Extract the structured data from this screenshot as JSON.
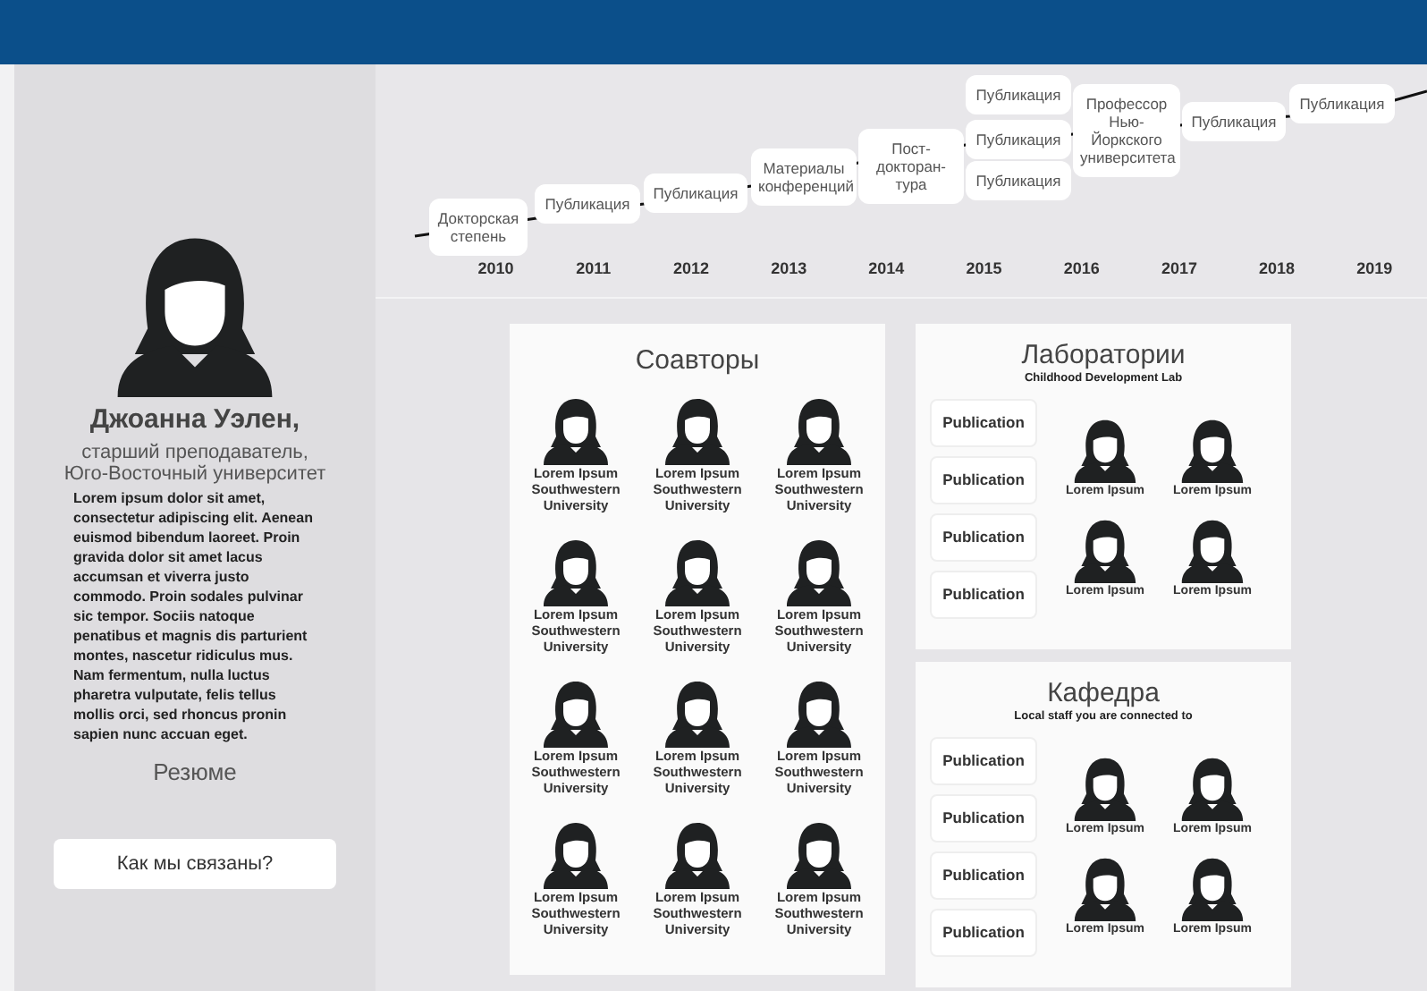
{
  "sidebar": {
    "name": "Джоанна Уэлен,",
    "subtitle": "старший преподаватель, Юго-Восточный университет",
    "bio": "Lorem ipsum dolor sit amet, consectetur adipiscing elit. Aenean euismod bibendum laoreet. Proin gravida dolor sit amet lacus accumsan et viverra justo commodo. Proin sodales pulvinar sic tempor. Sociis natoque penatibus et magnis dis parturient montes, nascetur ridiculus mus. Nam fermentum, nulla luctus pharetra vulputate, felis tellus mollis orci, sed rhoncus pronin sapien nunc accuan eget.",
    "resume_link": "Резюме",
    "connection_button": "Как мы связаны?"
  },
  "timeline": {
    "events": [
      {
        "label": "Докторская степень"
      },
      {
        "label": "Публикация"
      },
      {
        "label": "Публикация"
      },
      {
        "label": "Материалы конференций"
      },
      {
        "label": "Пост-\nдокторан-\nтура"
      },
      {
        "label": "Публикация"
      },
      {
        "label": "Публикация"
      },
      {
        "label": "Публикация"
      },
      {
        "label": "Профессор\nНью-\nЙоркского\nуниверситета"
      },
      {
        "label": "Публикация"
      },
      {
        "label": "Публикация"
      }
    ],
    "years": [
      "2010",
      "2011",
      "2012",
      "2013",
      "2014",
      "2015",
      "2016",
      "2017",
      "2018",
      "2019"
    ]
  },
  "coauthors": {
    "title": "Соавторы",
    "people": [
      {
        "name": "Lorem Ipsum Southwestern University"
      },
      {
        "name": "Lorem Ipsum Southwestern University"
      },
      {
        "name": "Lorem Ipsum Southwestern University"
      },
      {
        "name": "Lorem Ipsum Southwestern University"
      },
      {
        "name": "Lorem Ipsum Southwestern University"
      },
      {
        "name": "Lorem Ipsum Southwestern University"
      },
      {
        "name": "Lorem Ipsum Southwestern University"
      },
      {
        "name": "Lorem Ipsum Southwestern University"
      },
      {
        "name": "Lorem Ipsum Southwestern University"
      },
      {
        "name": "Lorem Ipsum Southwestern University"
      },
      {
        "name": "Lorem Ipsum Southwestern University"
      },
      {
        "name": "Lorem Ipsum Southwestern University"
      }
    ]
  },
  "labs": {
    "title": "Лаборатории",
    "subtitle": "Childhood Development Lab",
    "publications": [
      "Publication",
      "Publication",
      "Publication",
      "Publication"
    ],
    "people": [
      "Lorem Ipsum",
      "Lorem Ipsum",
      "Lorem Ipsum",
      "Lorem Ipsum"
    ]
  },
  "department": {
    "title": "Кафедра",
    "subtitle": "Local staff you are connected to",
    "publications": [
      "Publication",
      "Publication",
      "Publication",
      "Publication"
    ],
    "people": [
      "Lorem Ipsum",
      "Lorem Ipsum",
      "Lorem Ipsum",
      "Lorem Ipsum"
    ]
  }
}
